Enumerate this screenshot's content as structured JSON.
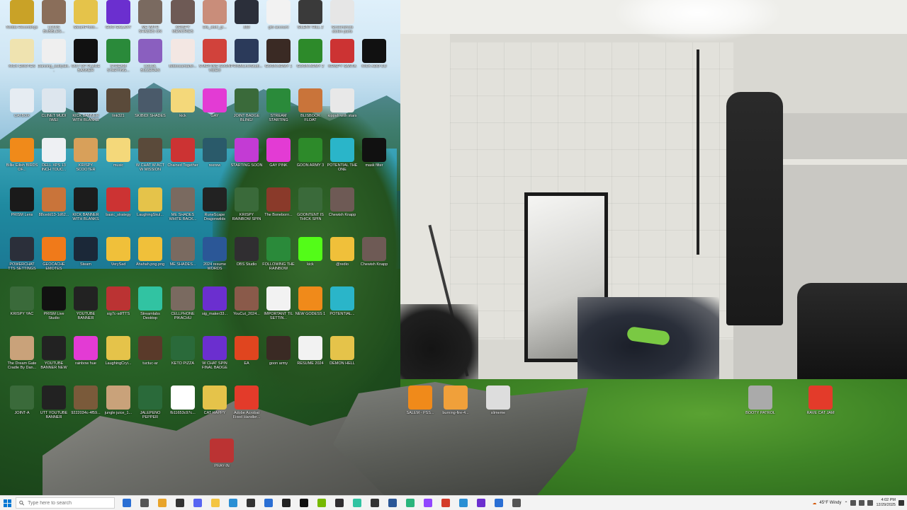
{
  "desktop": {
    "icons": [
      {
        "label": "Nvidia Recordings",
        "color": "#c9a227"
      },
      {
        "label": "LOUIS BUBBLEG...",
        "color": "#8a6e5a"
      },
      {
        "label": "SteamPhoto...",
        "color": "#e5c34a"
      },
      {
        "label": "GOO GALAXY",
        "color": "#6b2fcf"
      },
      {
        "label": "ME WITH SHADES ON",
        "color": "#7a6a60"
      },
      {
        "label": "KRISPY MEMORIES",
        "color": "#6e5a55"
      },
      {
        "label": "Dis_stuff_gr...",
        "color": "#c98d7a"
      },
      {
        "label": "333",
        "color": "#2b2f3a"
      },
      {
        "label": "gt5 account",
        "color": "#f2f2f2"
      },
      {
        "label": "SILENT HILL 2",
        "color": "#3a3a3a"
      },
      {
        "label": "Screenshots stolen parts",
        "color": "#e6e6e6"
      },
      {
        "label": "KICK EMOTES",
        "color": "#efe3b0"
      },
      {
        "label": "Dancing_sukiyaki...",
        "color": "#efefef"
      },
      {
        "label": "OUT OF PLACE BANNER",
        "color": "#111111"
      },
      {
        "label": "STREAM STARTING...",
        "color": "#2a8a3a"
      },
      {
        "label": "LOLOL BIZZERAN",
        "color": "#8a5fbf"
      },
      {
        "label": "Bibbosanta/Br...",
        "color": "#f3e7e3"
      },
      {
        "label": "STARTING SOON VIDEO",
        "color": "#d1423b"
      },
      {
        "label": "PRISMLiveStudi...",
        "color": "#2b3a5a"
      },
      {
        "label": "GOON ARMY 1",
        "color": "#3a2a24"
      },
      {
        "label": "GOON ARMY 2",
        "color": "#2d8a2a"
      },
      {
        "label": "KRISPY SANTA",
        "color": "#c33"
      },
      {
        "label": "KICK ADD CU",
        "color": "#111"
      },
      {
        "label": "CATBOX",
        "color": "#e6ecf2"
      },
      {
        "label": "CLINET MUDI IWEI",
        "color": "#dde6ee"
      },
      {
        "label": "KICK BANNER WITH BLANKS",
        "color": "#1c1c1c"
      },
      {
        "label": "link321",
        "color": "#5a4a3a"
      },
      {
        "label": "SKIBIDI SHADES",
        "color": "#4a5a6a"
      },
      {
        "label": "kick",
        "color": "#f4d87a"
      },
      {
        "label": "GAY",
        "color": "#e33bd4"
      },
      {
        "label": "JOINT BADGE BLING!",
        "color": "#3a6a3a"
      },
      {
        "label": "STREAM STARTING",
        "color": "#2a8a3a"
      },
      {
        "label": "BLISBOOK FLOAT",
        "color": "#c9743a"
      },
      {
        "label": "kippah with stars",
        "color": "#e8e8e8"
      },
      {
        "label": "Billie Eilish BIRDS OF...",
        "color": "#f08a1a"
      },
      {
        "label": "DELL XPS 13 INCH TOUC...",
        "color": "#eef0f3"
      },
      {
        "label": "KRISPY SCOOTER",
        "color": "#d8a05a"
      },
      {
        "label": "music",
        "color": "#f4d87a"
      },
      {
        "label": "W CHAT W ACT W MISSION",
        "color": "#5a4a3a"
      },
      {
        "label": "Chained Together",
        "color": "#c33"
      },
      {
        "label": "reerew",
        "color": "#2a5a6a"
      },
      {
        "label": "STARTING SOON",
        "color": "#c33bd4"
      },
      {
        "label": "GAY PINK",
        "color": "#e33bd4"
      },
      {
        "label": "GOON ARMY 3",
        "color": "#2d8a2a"
      },
      {
        "label": "POTENTIAL THE ONE",
        "color": "#2ab5c9"
      },
      {
        "label": "mask filter",
        "color": "#111"
      },
      {
        "label": "PRISM Lens",
        "color": "#1a1a1a"
      },
      {
        "label": "88cedd13-1d62...",
        "color": "#c9743a"
      },
      {
        "label": "KICK BANNER WITH BLANKS",
        "color": "#1c1c1c"
      },
      {
        "label": "basic_strategy",
        "color": "#c33"
      },
      {
        "label": "LaughingSkul...",
        "color": "#e5c34a"
      },
      {
        "label": "ME SHADES WHITE BACK...",
        "color": "#7a6a60"
      },
      {
        "label": "RuneScape Dragonwilds",
        "color": "#222"
      },
      {
        "label": "KRISPY RAINBOW SPIN",
        "color": "#3a6a3a"
      },
      {
        "label": "The Boneborn...",
        "color": "#8a3a2a"
      },
      {
        "label": "GOONTENT IS THICK SPIN",
        "color": "#3a6a3a"
      },
      {
        "label": "Chewish Knapp",
        "color": "#6e5a55"
      },
      {
        "label": "POWERCHAT TTS SETTINGS",
        "color": "#2b2f3a"
      },
      {
        "label": "GEOCACHE EMOTES",
        "color": "#f07a1a"
      },
      {
        "label": "Steam",
        "color": "#1b2838"
      },
      {
        "label": "VerySad",
        "color": "#f0c03a"
      },
      {
        "label": "Ahahah.png.png",
        "color": "#f0c03a"
      },
      {
        "label": "ME SHADES...",
        "color": "#7a6a60"
      },
      {
        "label": "2024 resume WORDS",
        "color": "#2b5797"
      },
      {
        "label": "OBS Studio",
        "color": "#302e31"
      },
      {
        "label": "FOLLOWING THE RAINBOW",
        "color": "#2a8a3a"
      },
      {
        "label": "kick",
        "color": "#53fc18"
      },
      {
        "label": "@redio",
        "color": "#f0c03a"
      },
      {
        "label": "Chewish Knapp",
        "color": "#6e5a55"
      },
      {
        "label": "KRISPY YAC",
        "color": "#3a6a3a"
      },
      {
        "label": "PRISM Live Studio",
        "color": "#111"
      },
      {
        "label": "YOUTUBE BANNER",
        "color": "#222"
      },
      {
        "label": "sig7c-sdfTTS",
        "color": "#b33"
      },
      {
        "label": "Streamlabs Desktop",
        "color": "#31c3a2"
      },
      {
        "label": "CELLPHONE PIKACHU",
        "color": "#7a6a60"
      },
      {
        "label": "sig_maker33...",
        "color": "#6b2fcf"
      },
      {
        "label": "YouCut_2024...",
        "color": "#8a5a4a"
      },
      {
        "label": "IMPORTANT TIL SETTIN...",
        "color": "#f2f2f2"
      },
      {
        "label": "NEW GODESS 1",
        "color": "#f08a1a"
      },
      {
        "label": "POTENTIAL...",
        "color": "#2ab5c9"
      },
      {
        "label": "The Dream Gate Cradle By Dan...",
        "color": "#c9a27a"
      },
      {
        "label": "YOUTUBE BANNER NEW",
        "color": "#222"
      },
      {
        "label": "rainbow hue",
        "color": "#e33bd4"
      },
      {
        "label": "LaughingCryi...",
        "color": "#e5c34a"
      },
      {
        "label": "tuctuc-ar",
        "color": "#5a3a2a"
      },
      {
        "label": "KETO PIZZA",
        "color": "#2a6a3a"
      },
      {
        "label": "W CHAT SPIN FINAL BADGE",
        "color": "#6b2fcf"
      },
      {
        "label": "EA",
        "color": "#e0451f"
      },
      {
        "label": "goon army",
        "color": "#3a2a24"
      },
      {
        "label": "RESUME 2024",
        "color": "#f2f2f2"
      },
      {
        "label": "DEMON HELL",
        "color": "#e5c34a"
      },
      {
        "label": "JOINT-A",
        "color": "#3a6a3a"
      },
      {
        "label": "UTT YOUTUBE BANNER",
        "color": "#222"
      },
      {
        "label": "9222034c-4f59...",
        "color": "#7a5a3a"
      },
      {
        "label": "jungle juice_1...",
        "color": "#c9a27a"
      },
      {
        "label": "JALEPENO PEPPER",
        "color": "#2a6a3a"
      },
      {
        "label": "fb11653c97c...",
        "color": "#fff"
      },
      {
        "label": "CAT HAPPY",
        "color": "#e5c34a"
      },
      {
        "label": "Adobe Acrobat Fixed Handler...",
        "color": "#e33b2a"
      },
      {
        "label": "SALEM - PSS...",
        "color": "#f08a1a"
      },
      {
        "label": "burning-fire-4...",
        "color": "#f0a03a"
      },
      {
        "label": "slimeme",
        "color": "#ddd"
      },
      {
        "label": "BOOTY PATROL",
        "color": "#aaa"
      },
      {
        "label": "RAVE CAT JAM",
        "color": "#e33b2a"
      },
      {
        "label": "PRAY-IN",
        "color": "#b33"
      }
    ]
  },
  "taskbar": {
    "search_placeholder": "Type here to search",
    "apps": [
      {
        "name": "edge-app-icon",
        "color": "#2a6fd4"
      },
      {
        "name": "taskview-icon",
        "color": "#555"
      },
      {
        "name": "chrome-app-icon",
        "color": "#e8a42a"
      },
      {
        "name": "pin-icon",
        "color": "#333"
      },
      {
        "name": "discord-app-icon",
        "color": "#5865f2"
      },
      {
        "name": "folder-app-icon",
        "color": "#f4c542"
      },
      {
        "name": "sling-app-icon",
        "color": "#2a8fd4"
      },
      {
        "name": "terminal-app-icon",
        "color": "#333"
      },
      {
        "name": "store-app-icon",
        "color": "#2a6fd4"
      },
      {
        "name": "mic-app-icon",
        "color": "#222"
      },
      {
        "name": "prism-app-icon",
        "color": "#111"
      },
      {
        "name": "nvidia-app-icon",
        "color": "#76b900"
      },
      {
        "name": "obs-app-icon",
        "color": "#302e31"
      },
      {
        "name": "streamlabs-app-icon",
        "color": "#31c3a2"
      },
      {
        "name": "capture-app-icon",
        "color": "#333"
      },
      {
        "name": "word-app-icon",
        "color": "#2b5797"
      },
      {
        "name": "maps-app-icon",
        "color": "#2ab57c"
      },
      {
        "name": "twitch-app-icon",
        "color": "#9146ff"
      },
      {
        "name": "camera-app-icon",
        "color": "#d43b2a"
      },
      {
        "name": "photos-app-icon",
        "color": "#2a8fd4"
      },
      {
        "name": "circle-app-icon",
        "color": "#6b2fcf"
      },
      {
        "name": "vpn-app-icon",
        "color": "#2a6fd4"
      },
      {
        "name": "settings-app-icon",
        "color": "#555"
      }
    ],
    "weather": "45°F  Windy",
    "time": "4:02 PM",
    "date": "12/29/2025"
  }
}
